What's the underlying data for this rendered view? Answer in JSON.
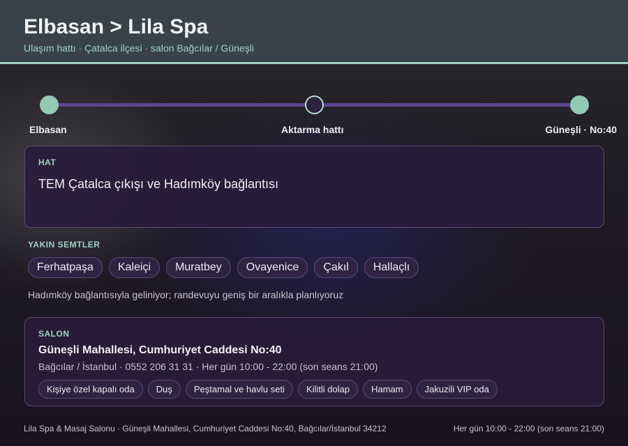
{
  "header": {
    "title": "Elbasan > Lila Spa",
    "subtitle": "Ulaşım hattı · Çatalca ilçesi · salon Bağcılar / Güneşli"
  },
  "route": {
    "stops": [
      {
        "label": "Elbasan",
        "style": "filled"
      },
      {
        "label": "Aktarma hattı",
        "style": "hollow"
      },
      {
        "label": "Güneşli · No:40",
        "style": "filled"
      }
    ]
  },
  "hat": {
    "label": "HAT",
    "text": "TEM Çatalca çıkışı ve Hadımköy bağlantısı"
  },
  "nearby": {
    "label": "YAKIN SEMTLER",
    "items": [
      "Ferhatpaşa",
      "Kaleiçi",
      "Muratbey",
      "Ovayenice",
      "Çakıl",
      "Hallaçlı"
    ],
    "note": "Hadımköy bağlantısıyla geliniyor; randevuyu geniş bir aralıkla planlıyoruz"
  },
  "salon": {
    "label": "SALON",
    "name": "Güneşli Mahallesi, Cumhuriyet Caddesi No:40",
    "meta": "Bağcılar / İstanbul · 0552 206 31 31 · Her gün 10:00 - 22:00 (son seans 21:00)",
    "amenities": [
      "Kişiye özel kapalı oda",
      "Duş",
      "Peştamal ve havlu seti",
      "Kilitli dolap",
      "Hamam",
      "Jakuzili VIP oda"
    ]
  },
  "footer": {
    "left": "Lila Spa & Masaj Salonu · Güneşli Mahallesi, Cumhuriyet Caddesi No:40, Bağcılar/İstanbul 34212",
    "right": "Her gün 10:00 - 22:00 (son seans 21:00)"
  },
  "colors": {
    "accent": "#9fd1c4",
    "route_line": "#5a4690",
    "stop_fill": "#93c9b3",
    "card_bg": "#281c3a"
  }
}
